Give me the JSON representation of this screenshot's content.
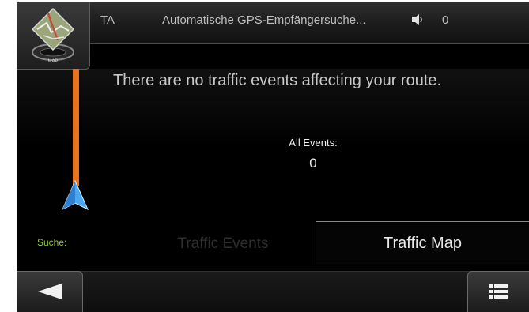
{
  "status_bar": {
    "ta_label": "TA",
    "gps_status": "Automatische GPS-Empfängersuche...",
    "volume_icon": "speaker-icon",
    "count": "0"
  },
  "map_button": {
    "icon": "map-icon",
    "label": "MAP"
  },
  "main": {
    "message": "There are no traffic events affecting your route.",
    "all_events_label": "All Events:",
    "all_events_count": "0",
    "route_bar_color": "#e8731f",
    "position_arrow_icon": "navigation-arrow-icon"
  },
  "tabs": {
    "search_label": "Suche:",
    "traffic_events_label": "Traffic Events",
    "traffic_map_label": "Traffic Map"
  },
  "bottom_bar": {
    "back_icon": "back-arrow-icon",
    "menu_icon": "menu-list-icon"
  }
}
